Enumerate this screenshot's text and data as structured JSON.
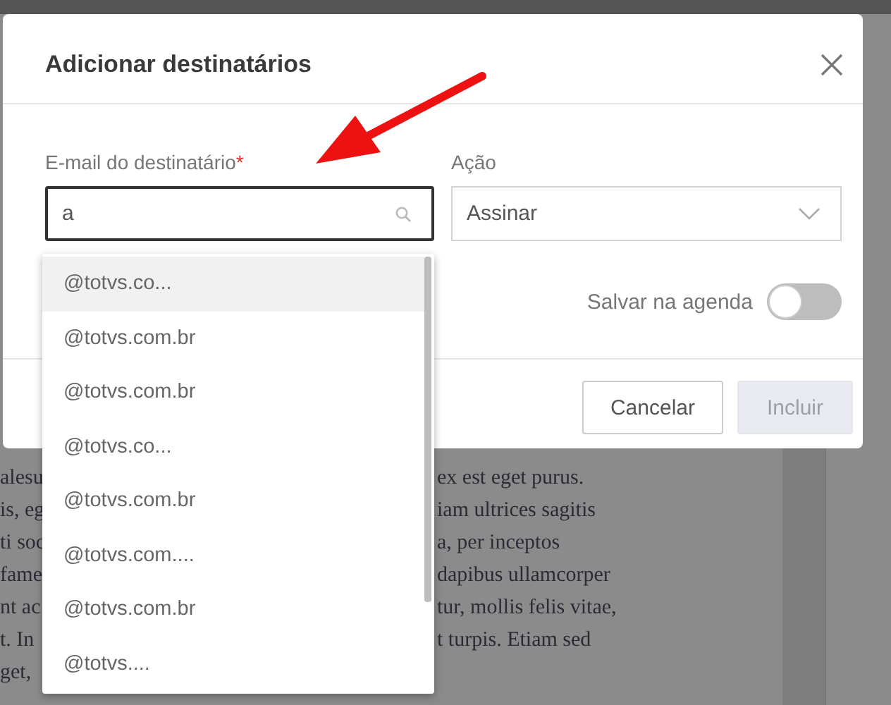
{
  "background_document": {
    "lines": [
      {
        "left": "alesu",
        "right": "ex est eget purus."
      },
      {
        "left": "is, eg",
        "right": "iam ultrices sagitis"
      },
      {
        "left": "ti soc",
        "right": "a, per inceptos"
      },
      {
        "left": "fame",
        "right": "dapibus ullamcorper"
      },
      {
        "left": "nt ac",
        "right": "tur, mollis felis vitae,"
      },
      {
        "left": "t. In",
        "right": "t turpis. Etiam sed"
      },
      {
        "left": "get,"
      }
    ]
  },
  "dialog": {
    "title": "Adicionar destinatários",
    "email_field": {
      "label": "E-mail do destinatário",
      "required_mark": "*",
      "value": "a",
      "focused": true
    },
    "action_field": {
      "label": "Ação",
      "value": "Assinar"
    },
    "save_toggle": {
      "label": "Salvar na agenda",
      "on": false
    },
    "buttons": [
      {
        "label": "Cancelar",
        "disabled": false
      },
      {
        "label": "Incluir",
        "disabled": true
      }
    ]
  },
  "suggestions": [
    {
      "text": "@totvs.co...",
      "selected": true
    },
    {
      "text": "@totvs.com.br",
      "selected": false
    },
    {
      "text": "@totvs.com.br",
      "selected": false
    },
    {
      "text": "@totvs.co...",
      "selected": false
    },
    {
      "text": "@totvs.com.br",
      "selected": false
    },
    {
      "text": "@totvs.com....",
      "selected": false
    },
    {
      "text": "@totvs.com.br",
      "selected": false
    },
    {
      "text": "@totvs....",
      "selected": false
    }
  ],
  "annotation": {
    "kind": "arrow",
    "color": "#ee1111"
  }
}
